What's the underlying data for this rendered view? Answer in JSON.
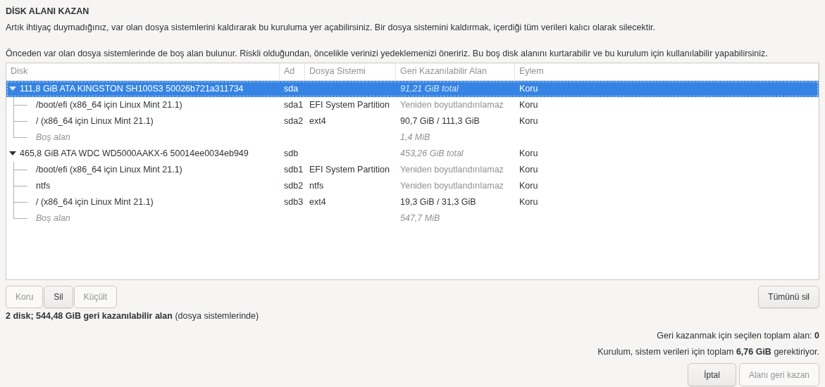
{
  "title": "DİSK ALANI KAZAN",
  "intro": "Artık ihtiyaç duymadığınız, var olan dosya sistemlerini kaldırarak bu kuruluma yer açabilirsiniz.  Bir dosya sistemini kaldırmak, içerdiği tüm verileri kalıcı olarak silecektir.",
  "note": "Önceden var olan dosya sistemlerinde de boş alan bulunur. Riskli olduğundan, öncelikle verinizi yedeklemenizi öneririz. Bu boş disk alanını kurtarabilir ve bu kurulum için kullanılabilir yapabilirsiniz.",
  "table": {
    "columns": [
      "Disk",
      "Ad",
      "Dosya Sistemi",
      "Geri Kazanılabilir Alan",
      "Eylem"
    ],
    "rows": [
      {
        "kind": "disk",
        "name": "111,8 GiB ATA KINGSTON SH100S3 50026b721a311734",
        "ad": "sda",
        "reclaim": "91,21 GiB total",
        "action": "Koru",
        "selected": true,
        "expanded": true,
        "children": [
          {
            "kind": "partition",
            "name": "/boot/efi (x86_64 için Linux Mint 21.1)",
            "ad": "sda1",
            "fs": "EFI System Partition",
            "reclaim": "Yeniden boyutlandırılamaz",
            "reclaim_muted": true,
            "action": "Koru",
            "selected": false
          },
          {
            "kind": "partition",
            "name": "/ (x86_64 için Linux Mint 21.1)",
            "ad": "sda2",
            "fs": "ext4",
            "reclaim": "90,7 GiB / 111,3 GiB",
            "reclaim_muted": false,
            "action": "Koru",
            "selected": false
          },
          {
            "kind": "free",
            "name": "Boş alan",
            "reclaim": "1,4 MiB",
            "selected": false
          }
        ]
      },
      {
        "kind": "disk",
        "name": "465,8 GiB ATA WDC WD5000AAKX-6 50014ee0034eb949",
        "ad": "sdb",
        "reclaim": "453,26 GiB total",
        "action": "Koru",
        "selected": false,
        "expanded": true,
        "children": [
          {
            "kind": "partition",
            "name": "/boot/efi (x86_64 için Linux Mint 21.1)",
            "ad": "sdb1",
            "fs": "EFI System Partition",
            "reclaim": "Yeniden boyutlandırılamaz",
            "reclaim_muted": true,
            "action": "Koru",
            "selected": false
          },
          {
            "kind": "partition",
            "name": "ntfs",
            "ad": "sdb2",
            "fs": "ntfs",
            "reclaim": "Yeniden boyutlandırılamaz",
            "reclaim_muted": true,
            "action": "Koru",
            "selected": false
          },
          {
            "kind": "partition",
            "name": "/ (x86_64 için Linux Mint 21.1)",
            "ad": "sdb3",
            "fs": "ext4",
            "reclaim": "19,3 GiB / 31,3 GiB",
            "reclaim_muted": false,
            "action": "Koru",
            "selected": false
          },
          {
            "kind": "free",
            "name": "Boş alan",
            "reclaim": "547,7 MiB",
            "selected": false
          }
        ]
      }
    ]
  },
  "row_buttons": [
    {
      "label": "Koru",
      "disabled": true
    },
    {
      "label": "Sil",
      "disabled": false
    },
    {
      "label": "Küçült",
      "disabled": true
    }
  ],
  "delete_all_button": {
    "label": "Tümünü sil",
    "disabled": false
  },
  "summary": "**2 disk; 544,48 GiB geri kazanılabilir alan** (dosya sistemlerinde)",
  "selected_total": "Geri kazanmak için seçilen toplam alan: **0**",
  "required": "Kurulum, sistem verileri için toplam **6,76 GiB** gerektiriyor.",
  "footer_buttons": [
    {
      "label": "İptal",
      "disabled": false
    },
    {
      "label": "Alanı geri kazan",
      "disabled": true
    }
  ]
}
